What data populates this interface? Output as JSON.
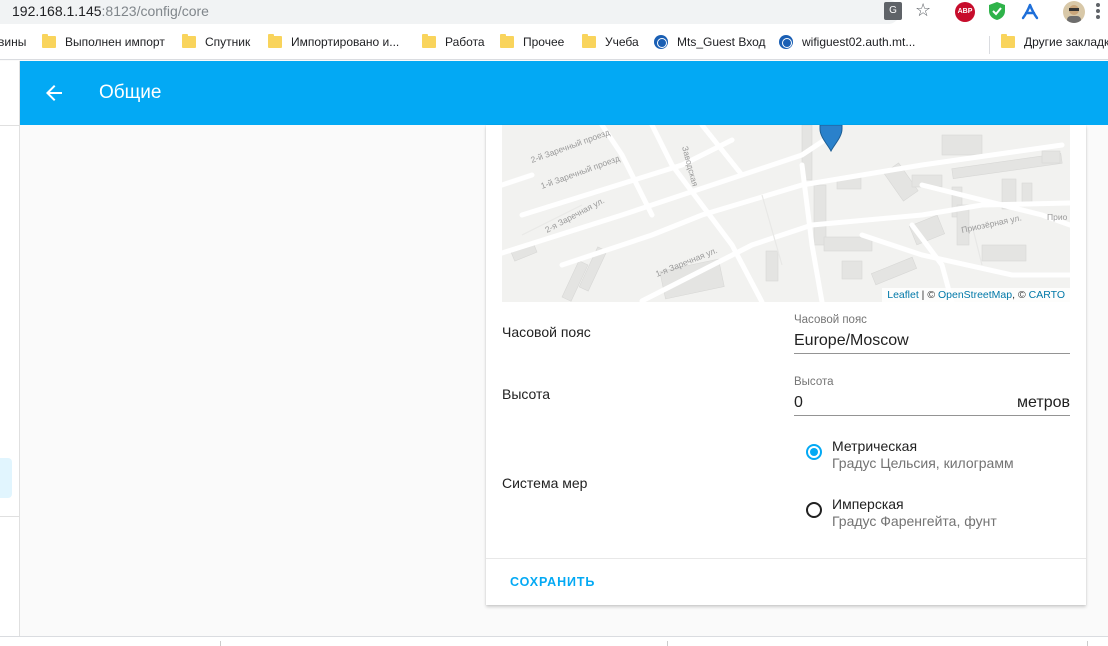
{
  "browser": {
    "url_host": "192.168.1.145",
    "url_path": ":8123/config/core",
    "icons": [
      "translate-icon",
      "star-icon",
      "adblock-icon",
      "shield-icon",
      "extension-icon",
      "avatar",
      "menu-icon"
    ],
    "abp_label": "ABP"
  },
  "bookmarks": {
    "items": [
      {
        "label": "вины",
        "icon": "none"
      },
      {
        "label": "Выполнен импорт",
        "icon": "folder-icon"
      },
      {
        "label": "Спутник",
        "icon": "folder-icon"
      },
      {
        "label": "Импортировано и...",
        "icon": "folder-icon"
      },
      {
        "label": "Работа",
        "icon": "folder-icon"
      },
      {
        "label": "Прочее",
        "icon": "folder-icon"
      },
      {
        "label": "Учеба",
        "icon": "folder-icon"
      },
      {
        "label": "Mts_Guest Вход",
        "icon": "globe-icon"
      },
      {
        "label": "wifiguest02.auth.mt...",
        "icon": "globe-icon"
      }
    ],
    "other_label": "Другие закладк"
  },
  "header": {
    "title": "Общие",
    "color": "#03a9f4"
  },
  "map": {
    "streets": [
      "2-й Заречный проезд",
      "1-й Заречный проезд",
      "2-я Заречная ул.",
      "1-я Заречная ул.",
      "Приозёрная ул.",
      "Прио",
      "Заводская"
    ],
    "attribution": {
      "leaflet": "Leaflet",
      "sep1": " | © ",
      "osm": "OpenStreetMap",
      "sep2": ", © ",
      "carto": "CARTO"
    }
  },
  "timezone": {
    "row_label": "Часовой пояс",
    "field_label": "Часовой пояс",
    "value": "Europe/Moscow"
  },
  "elevation": {
    "row_label": "Высота",
    "field_label": "Высота",
    "value": "0",
    "suffix": "метров"
  },
  "units": {
    "row_label": "Система мер",
    "options": [
      {
        "title": "Метрическая",
        "subtitle": "Градус Цельсия, килограмм",
        "selected": true
      },
      {
        "title": "Имперская",
        "subtitle": "Градус Фаренгейта, фунт",
        "selected": false
      }
    ]
  },
  "actions": {
    "save_label": "СОХРАНИТЬ"
  }
}
